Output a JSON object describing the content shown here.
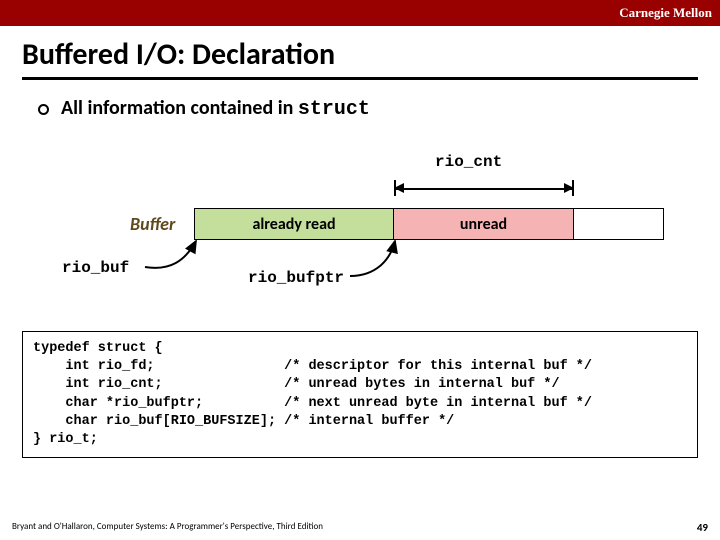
{
  "brand": "Carnegie Mellon",
  "title": "Buffered I/O: Declaration",
  "bullet": {
    "prefix": "All information contained in ",
    "mono": "struct"
  },
  "diagram": {
    "buffer_label": "Buffer",
    "seg_read": "already read",
    "seg_unread": "unread",
    "cnt_label": "rio_cnt",
    "buf_label": "rio_buf",
    "bufptr_label": "rio_bufptr"
  },
  "code": {
    "l1": "typedef struct {",
    "l2": "    int rio_fd;                /* descriptor for this internal buf */",
    "l3": "    int rio_cnt;               /* unread bytes in internal buf */",
    "l4": "    char *rio_bufptr;          /* next unread byte in internal buf */",
    "l5": "    char rio_buf[RIO_BUFSIZE]; /* internal buffer */",
    "l6": "} rio_t;"
  },
  "footer": {
    "left": "Bryant and O'Hallaron, Computer Systems: A Programmer's Perspective, Third Edition",
    "page": "49"
  }
}
